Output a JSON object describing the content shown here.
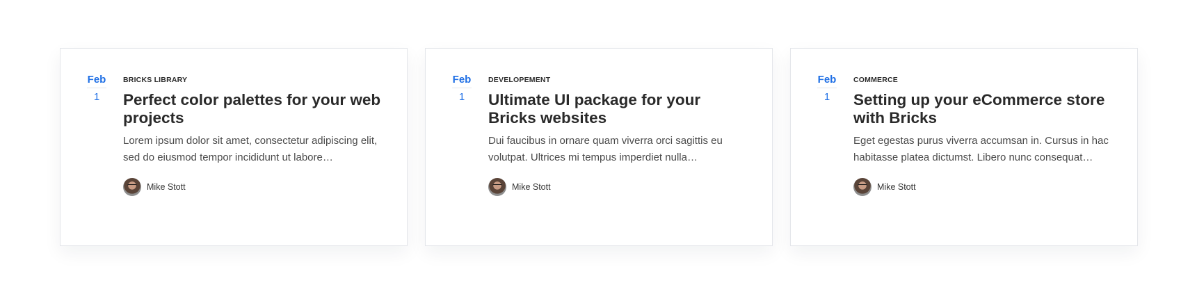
{
  "cards": [
    {
      "date": {
        "month": "Feb",
        "day": "1"
      },
      "category": "BRICKS LIBRARY",
      "title": "Perfect color palettes for your web projects",
      "excerpt": "Lorem ipsum dolor sit amet, consectetur adipiscing elit, sed do eiusmod tempor incididunt ut labore…",
      "author": {
        "name": "Mike Stott"
      }
    },
    {
      "date": {
        "month": "Feb",
        "day": "1"
      },
      "category": "DEVELOPEMENT",
      "title": "Ultimate UI package for your Bricks websites",
      "excerpt": "Dui faucibus in ornare quam viverra orci sagittis eu volutpat. Ultrices mi tempus imperdiet nulla…",
      "author": {
        "name": "Mike Stott"
      }
    },
    {
      "date": {
        "month": "Feb",
        "day": "1"
      },
      "category": "COMMERCE",
      "title": "Setting up your eCommerce store with Bricks",
      "excerpt": "Eget egestas purus viverra accumsan in. Cursus in hac habitasse platea dictumst. Libero nunc consequat…",
      "author": {
        "name": "Mike Stott"
      }
    }
  ],
  "colors": {
    "accent": "#1f6fe5",
    "title": "#2a2a2a",
    "text": "#4a4a4a",
    "border": "#e4e6ea"
  }
}
